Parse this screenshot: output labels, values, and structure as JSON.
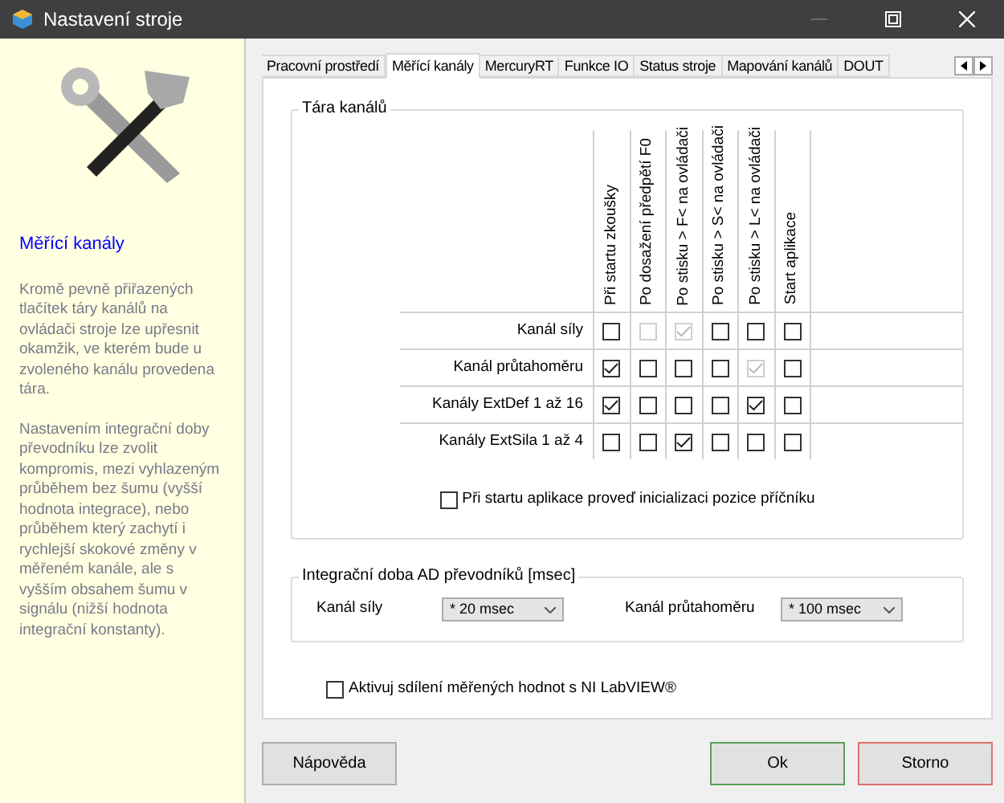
{
  "window": {
    "title": "Nastavení stroje"
  },
  "sidebar": {
    "heading": "Měřící kanály",
    "paragraphs": [
      "Kromě pevně přiřazených tlačítek táry kanálů na ovládači stroje lze upřesnit okamžik, ve kterém bude u zvoleného kanálu provedena tára.",
      "Nastavením integrační doby převodníku lze zvolit kompromis, mezi vyhlazeným průběhem bez šumu (vyšší hodnota integrace), nebo průběhem který zachytí i rychlejší skokové změny v měřeném kanále, ale s vyšším obsahem šumu v signálu (nižší hodnota integrační konstanty)."
    ]
  },
  "tabs": [
    {
      "label": "Pracovní prostředí",
      "selected": false
    },
    {
      "label": "Měřící kanály",
      "selected": true
    },
    {
      "label": "MercuryRT",
      "selected": false
    },
    {
      "label": "Funkce IO",
      "selected": false
    },
    {
      "label": "Status stroje",
      "selected": false
    },
    {
      "label": "Mapování kanálů",
      "selected": false
    },
    {
      "label": "DOUT",
      "selected": false
    }
  ],
  "tare_group": {
    "title": "Tára kanálů",
    "columns": [
      "Při startu zkoušky",
      "Po dosažení předpětí F0",
      "Po stisku > F< na ovládači",
      "Po stisku > S< na ovládači",
      "Po stisku > L< na ovládači",
      "Start aplikace"
    ],
    "rows": [
      {
        "label": "Kanál síly",
        "cells": [
          {
            "checked": false,
            "disabled": false
          },
          {
            "checked": false,
            "disabled": true
          },
          {
            "checked": true,
            "disabled": true
          },
          {
            "checked": false,
            "disabled": false
          },
          {
            "checked": false,
            "disabled": false
          },
          {
            "checked": false,
            "disabled": false
          }
        ]
      },
      {
        "label": "Kanál průtahoměru",
        "cells": [
          {
            "checked": true,
            "disabled": false
          },
          {
            "checked": false,
            "disabled": false
          },
          {
            "checked": false,
            "disabled": false
          },
          {
            "checked": false,
            "disabled": false
          },
          {
            "checked": true,
            "disabled": true
          },
          {
            "checked": false,
            "disabled": false
          }
        ]
      },
      {
        "label": "Kanály ExtDef 1 až 16",
        "cells": [
          {
            "checked": true,
            "disabled": false
          },
          {
            "checked": false,
            "disabled": false
          },
          {
            "checked": false,
            "disabled": false
          },
          {
            "checked": false,
            "disabled": false
          },
          {
            "checked": true,
            "disabled": false
          },
          {
            "checked": false,
            "disabled": false
          }
        ]
      },
      {
        "label": "Kanály ExtSila 1 až 4",
        "cells": [
          {
            "checked": false,
            "disabled": false
          },
          {
            "checked": false,
            "disabled": false
          },
          {
            "checked": true,
            "disabled": false
          },
          {
            "checked": false,
            "disabled": false
          },
          {
            "checked": false,
            "disabled": false
          },
          {
            "checked": false,
            "disabled": false
          }
        ]
      }
    ],
    "init_option": {
      "label": "Při startu aplikace proveď inicializaci pozice příčníku",
      "checked": false
    }
  },
  "integration_group": {
    "title": "Integrační doba AD převodníků [msec]",
    "fields": [
      {
        "label": "Kanál síly",
        "value": "* 20 msec"
      },
      {
        "label": "Kanál průtahoměru",
        "value": "* 100 msec"
      }
    ]
  },
  "labview_option": {
    "label": "Aktivuj sdílení měřených hodnot s NI LabVIEW®",
    "checked": false
  },
  "buttons": [
    {
      "label": "Nápověda",
      "kind": "plain"
    },
    {
      "label": "Ok",
      "kind": "ok"
    },
    {
      "label": "Storno",
      "kind": "cancel"
    }
  ]
}
